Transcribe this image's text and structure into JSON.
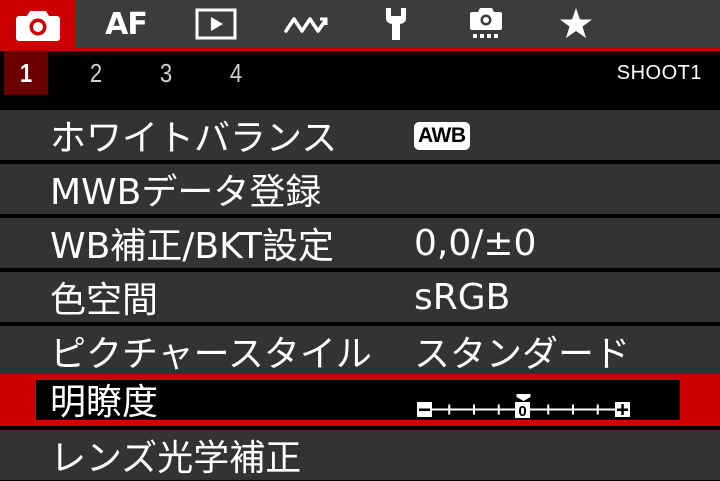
{
  "tabs": [
    {
      "icon": "camera-icon",
      "active": true
    },
    {
      "label": "AF",
      "active": false
    },
    {
      "icon": "playback-icon",
      "active": false
    },
    {
      "icon": "wave-icon",
      "active": false
    },
    {
      "icon": "wrench-icon",
      "active": false
    },
    {
      "icon": "custom-camera-icon",
      "active": false
    },
    {
      "icon": "star-icon",
      "active": false
    }
  ],
  "pages": [
    "1",
    "2",
    "3",
    "4"
  ],
  "active_page": "1",
  "page_code": "SHOOT1",
  "menu": [
    {
      "label": "ホワイトバランス",
      "value": "AWB",
      "value_type": "badge"
    },
    {
      "label": "MWBデータ登録",
      "value": ""
    },
    {
      "label": "WB補正/BKT設定",
      "value": "0,0/±0"
    },
    {
      "label": "色空間",
      "value": "sRGB"
    },
    {
      "label": "ピクチャースタイル",
      "value": "スタンダード"
    },
    {
      "label": "明瞭度",
      "value_type": "scale",
      "scale": {
        "min_label": "−",
        "max_label": "+",
        "center_label": "0",
        "value": 0,
        "min": -4,
        "max": 4
      },
      "selected": true
    },
    {
      "label": "レンズ光学補正",
      "value": ""
    }
  ],
  "colors": {
    "accent": "#cc0000",
    "tabbar_bg": "#3c3c3c",
    "row_bg": "#333333",
    "active_page_bg": "#6b0000"
  }
}
